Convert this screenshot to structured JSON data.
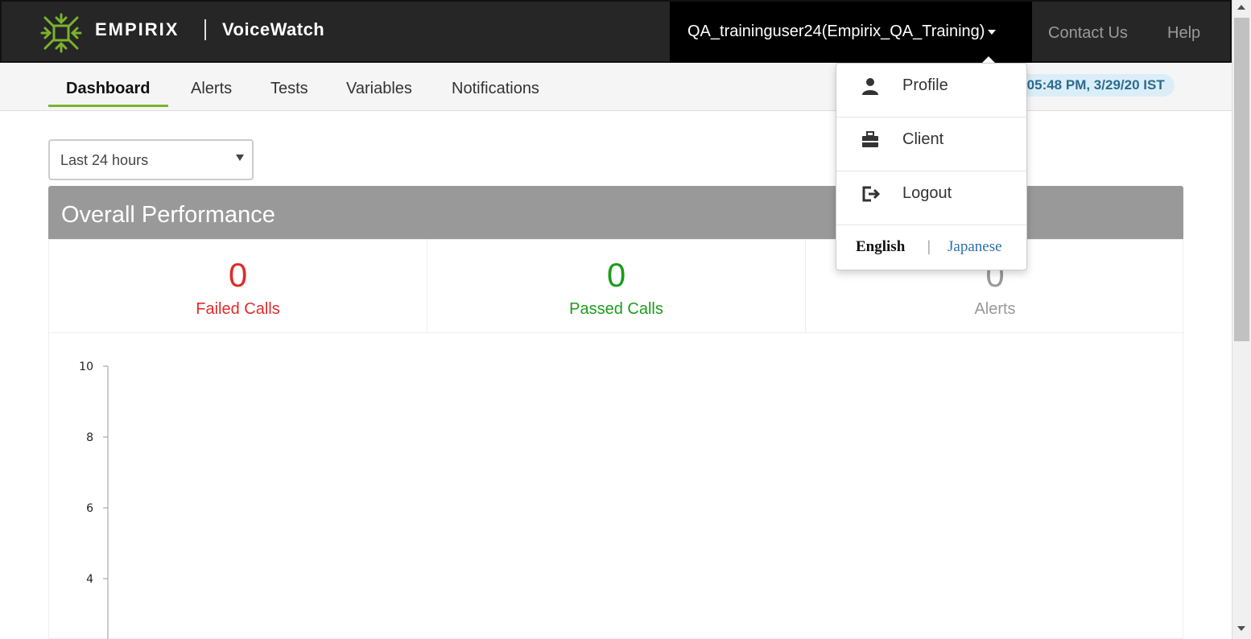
{
  "header": {
    "brand": "EMPIRIX",
    "product": "VoiceWatch",
    "user_menu_label": "QA_traininguser24(Empirix_QA_Training)",
    "contact_label": "Contact Us",
    "help_label": "Help",
    "logo_icon": "empirix-logo-icon"
  },
  "nav": {
    "tabs": [
      {
        "label": "Dashboard",
        "active": true
      },
      {
        "label": "Alerts",
        "active": false
      },
      {
        "label": "Tests",
        "active": false
      },
      {
        "label": "Variables",
        "active": false
      },
      {
        "label": "Notifications",
        "active": false
      }
    ],
    "timestamp": ":05:48 PM, 3/29/20 IST"
  },
  "filters": {
    "range_selected": "Last 24 hours"
  },
  "panel": {
    "title": "Overall Performance",
    "metrics": [
      {
        "value": "0",
        "label": "Failed Calls",
        "color": "#e02b2b"
      },
      {
        "value": "0",
        "label": "Passed Calls",
        "color": "#1c9c1c"
      },
      {
        "value": "0",
        "label": "Alerts",
        "color": "#999999"
      }
    ]
  },
  "chart_data": {
    "type": "line",
    "y_ticks": [
      10,
      8,
      6,
      4
    ],
    "ylim": [
      0,
      10
    ],
    "series": []
  },
  "user_dropdown": {
    "items": [
      {
        "label": "Profile",
        "icon": "user-icon"
      },
      {
        "label": "Client",
        "icon": "briefcase-icon"
      },
      {
        "label": "Logout",
        "icon": "logout-icon"
      }
    ],
    "languages": {
      "english": "English",
      "separator": "|",
      "japanese": "Japanese"
    }
  },
  "colors": {
    "accent_green": "#7ab32e",
    "topbar_bg": "#262626",
    "panel_header": "#999999",
    "link_blue": "#2f6fa6"
  }
}
